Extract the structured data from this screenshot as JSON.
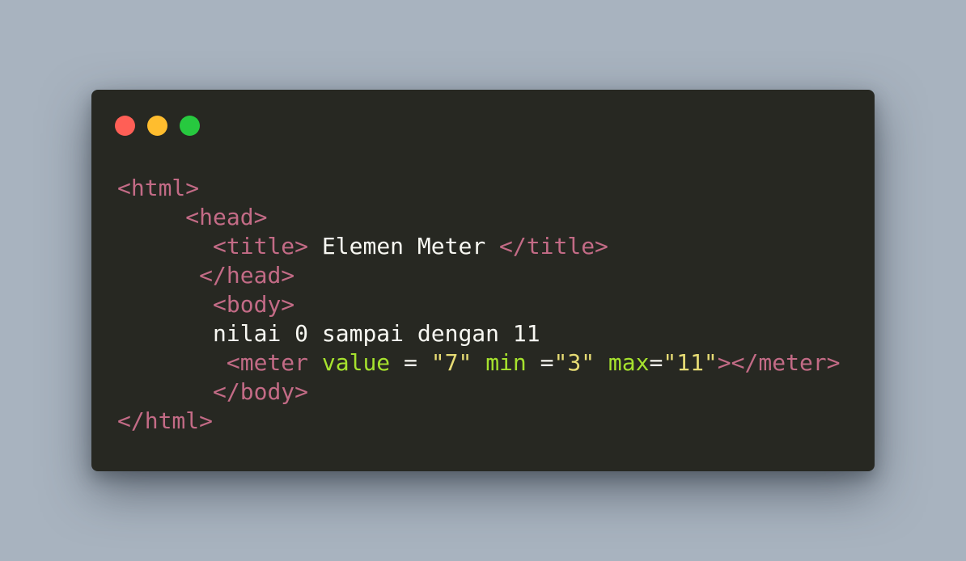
{
  "window": {
    "controls": {
      "close": "close-dot",
      "minimize": "minimize-dot",
      "maximize": "maximize-dot"
    },
    "colors": {
      "background": "#272822",
      "close": "#ff5f56",
      "minimize": "#ffbd2e",
      "maximize": "#27c93f",
      "tag": "#c36b86",
      "text": "#f8f8f2",
      "attribute": "#a6e22e",
      "string": "#e6db74"
    }
  },
  "code": {
    "lines": [
      {
        "indent": "",
        "tokens": [
          "<html>"
        ]
      },
      {
        "indent": "     ",
        "tokens": [
          "<head>"
        ]
      },
      {
        "indent": "       ",
        "tokens": [
          "<title>",
          " Elemen Meter ",
          "</title>"
        ]
      },
      {
        "indent": "      ",
        "tokens": [
          "</head>"
        ]
      },
      {
        "indent": "       ",
        "tokens": [
          "<body>"
        ]
      },
      {
        "indent": "       ",
        "tokens": [
          "nilai 0 sampai dengan 11"
        ]
      },
      {
        "indent": "        ",
        "tokens": [
          "<meter",
          " ",
          "value",
          " = ",
          "\"7\"",
          " ",
          "min",
          " =",
          "\"3\"",
          " ",
          "max",
          "=",
          "\"11\"",
          "></meter>"
        ]
      },
      {
        "indent": "       ",
        "tokens": [
          "</body>"
        ]
      },
      {
        "indent": "",
        "tokens": [
          "</html>"
        ]
      }
    ]
  }
}
